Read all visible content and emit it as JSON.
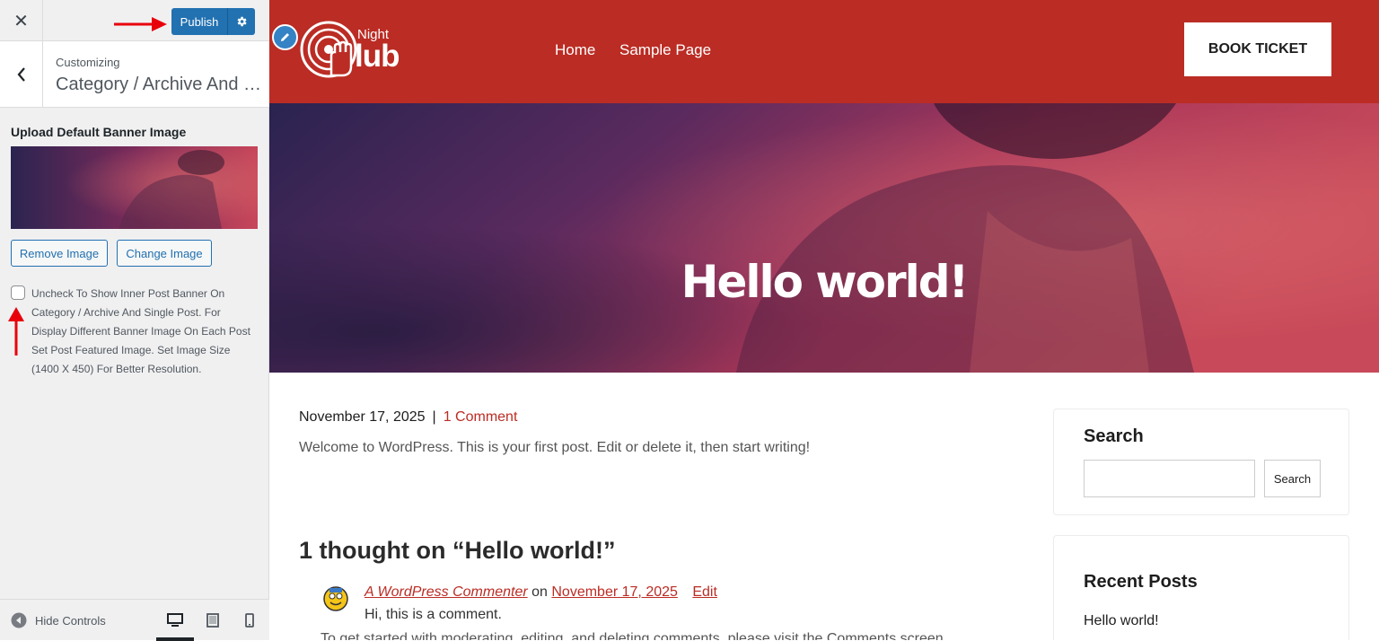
{
  "sidebar": {
    "publish_label": "Publish",
    "customizing_label": "Customizing",
    "section_title": "Category / Archive And Single Post",
    "banner_label": "Upload Default Banner Image",
    "remove_image_label": "Remove Image",
    "change_image_label": "Change Image",
    "checkbox_description": "Uncheck To Show Inner Post Banner On Category / Archive And Single Post. For Display Different Banner Image On Each Post Set Post Featured Image. Set Image Size (1400 X 450) For Better Resolution.",
    "checkbox_checked": false,
    "hide_controls_label": "Hide Controls",
    "active_device": "desktop"
  },
  "site": {
    "logo_top": "Night",
    "logo_bottom": "lub",
    "nav": [
      "Home",
      "Sample Page"
    ],
    "cta_label": "BOOK TICKET",
    "header_color": "#bb2c24",
    "hero_title": "Hello world!"
  },
  "post": {
    "date": "November 17, 2025",
    "separator": "|",
    "comment_count_link": "1 Comment",
    "excerpt": "Welcome to WordPress. This is your first post. Edit or delete it, then start writing!"
  },
  "comments": {
    "title": "1 thought on “Hello world!”",
    "author": "A WordPress Commenter",
    "on": "on",
    "date": "November 17, 2025",
    "edit": "Edit",
    "text": "Hi, this is a comment.",
    "more": "To get started with moderating, editing, and deleting comments, please visit the Comments screen"
  },
  "widgets": {
    "search_title": "Search",
    "search_button": "Search",
    "search_placeholder": "",
    "recent_title": "Recent Posts",
    "recent_items": [
      "Hello world!"
    ]
  },
  "icons": {
    "close": "close-icon",
    "gear": "gear-icon",
    "back": "chevron-left-icon",
    "hide": "arrow-left-circle-icon",
    "desktop": "desktop-icon",
    "tablet": "tablet-icon",
    "mobile": "mobile-icon",
    "pencil": "pencil-icon"
  },
  "colors": {
    "accent": "#2271b1",
    "brand_red": "#bb2c24",
    "annotation_arrow": "#e8000b"
  }
}
